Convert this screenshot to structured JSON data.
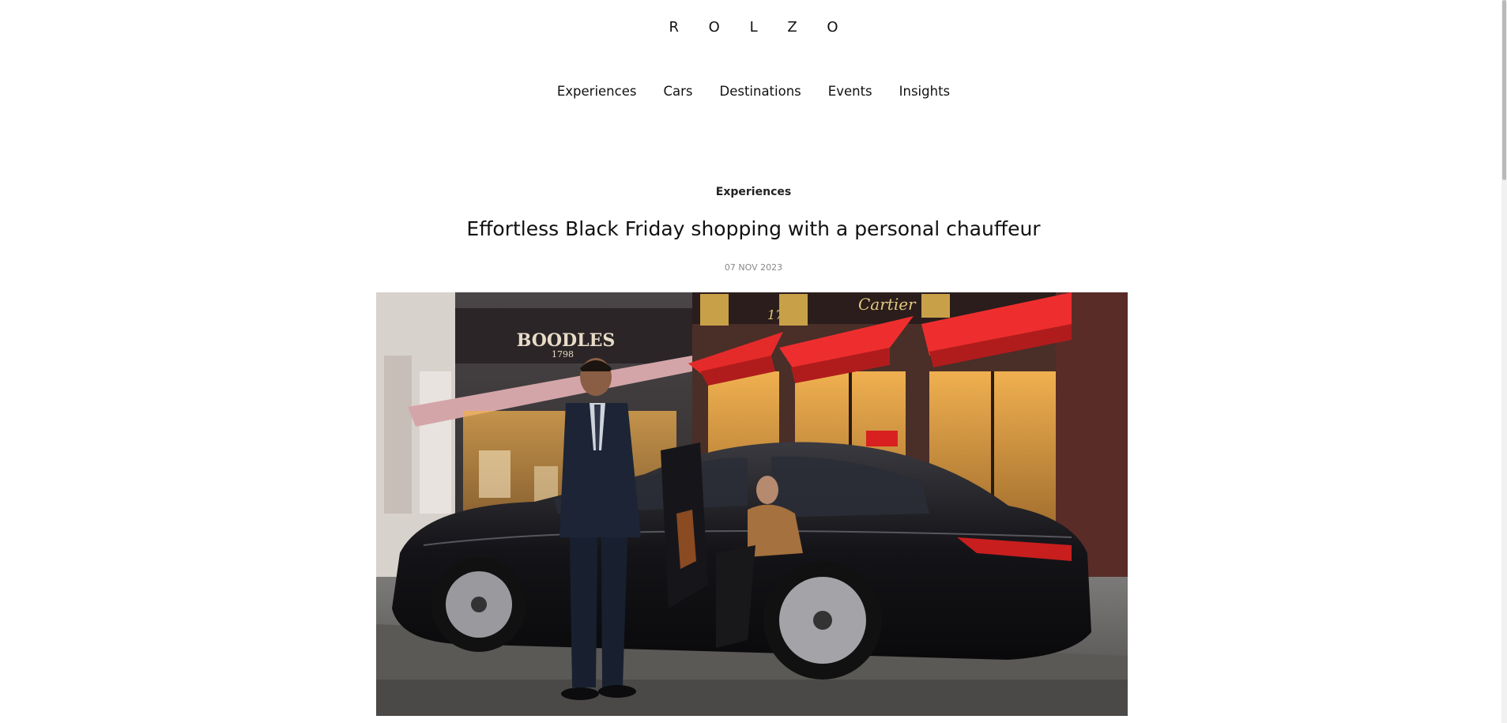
{
  "header": {
    "logo": "R O L Z O"
  },
  "nav": {
    "items": [
      "Experiences",
      "Cars",
      "Destinations",
      "Events",
      "Insights"
    ]
  },
  "article": {
    "category": "Experiences",
    "title": "Effortless Black Friday shopping with a personal chauffeur",
    "date": "07 NOV 2023"
  },
  "hero": {
    "signs": {
      "left_store": "BOODLES",
      "left_store_year": "1798",
      "right_store": "Cartier",
      "street_number": "177"
    }
  }
}
